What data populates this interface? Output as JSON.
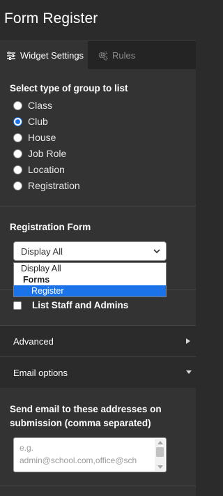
{
  "header": {
    "title": "Form Register"
  },
  "tabs": [
    {
      "label": "Widget Settings",
      "icon": "sliders-icon",
      "active": true
    },
    {
      "label": "Rules",
      "icon": "gears-icon",
      "active": false
    }
  ],
  "group_type": {
    "title": "Select type of group to list",
    "options": [
      "Class",
      "Club",
      "House",
      "Job Role",
      "Location",
      "Registration"
    ],
    "selected": "Club"
  },
  "registration_form": {
    "title": "Registration Form",
    "select_value": "Display All",
    "dropdown_options": [
      {
        "label": "Display All",
        "kind": "option"
      },
      {
        "label": "Forms",
        "kind": "group"
      },
      {
        "label": "Register",
        "kind": "option",
        "highlighted": true
      }
    ]
  },
  "list_staff": {
    "label": "List Staff and Admins",
    "checked": false
  },
  "accordions": {
    "advanced": {
      "label": "Advanced",
      "expanded": false
    },
    "email_options": {
      "label": "Email options",
      "expanded": true
    }
  },
  "email": {
    "label": "Send email to these addresses on submission (comma separated)",
    "placeholder": "e.g.\nadmin@school.com,office@sch"
  },
  "colors": {
    "accent": "#1a73e8",
    "panel_bg": "#333333",
    "header_bg": "#2b2b2b"
  }
}
